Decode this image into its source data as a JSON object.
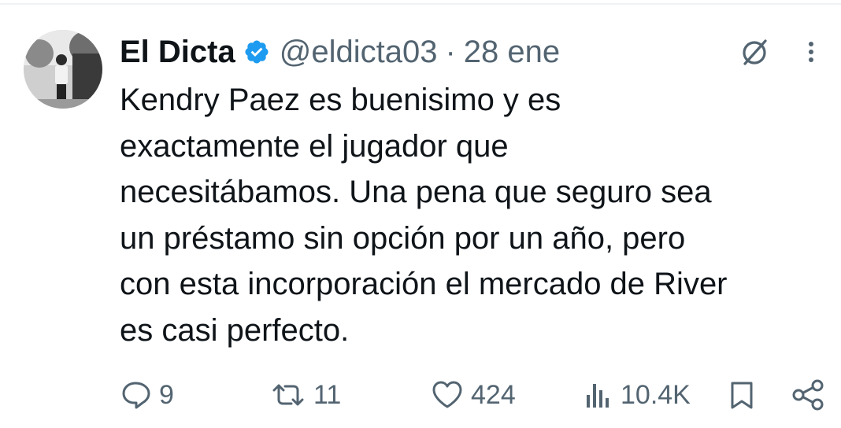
{
  "author": {
    "display_name": "El Dicta",
    "handle": "@eldicta03",
    "separator": "·",
    "date": "28 ene",
    "verified": true
  },
  "tweet": {
    "lines": [
      "Kendry Paez es buenisimo y es",
      "exactamente el jugador que",
      "necesitábamos. Una pena que seguro sea",
      "un préstamo sin opción por un año, pero",
      "con esta incorporación el mercado de River",
      "es casi perfecto."
    ]
  },
  "actions": {
    "replies": "9",
    "reposts": "11",
    "likes": "424",
    "views": "10.4K"
  },
  "icons": {
    "verified": "verified-badge-icon",
    "grok": "grok-icon",
    "more": "more-vertical-icon",
    "reply": "reply-icon",
    "repost": "repost-icon",
    "like": "heart-icon",
    "views": "views-icon",
    "bookmark": "bookmark-icon",
    "share": "share-icon"
  },
  "colors": {
    "text": "#0f1419",
    "secondary": "#536471",
    "verified": "#1d9bf0"
  }
}
